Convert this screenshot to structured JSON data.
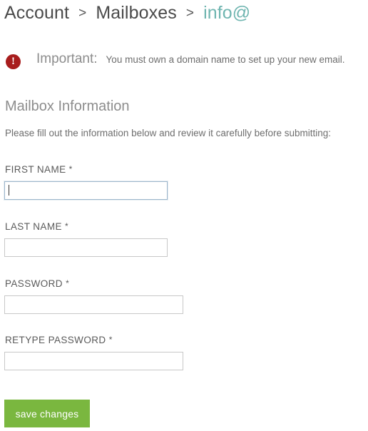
{
  "breadcrumb": {
    "items": [
      {
        "label": "Account",
        "current": false
      },
      {
        "label": "Mailboxes",
        "current": false
      },
      {
        "label": "info@",
        "current": true
      }
    ],
    "separator": ">"
  },
  "notice": {
    "icon": "alert-circle-icon",
    "glyph": "!",
    "label": "Important:",
    "message": "You must own a domain name to set up your new email."
  },
  "section": {
    "title": "Mailbox Information",
    "intro": "Please fill out the information below and review it carefully before submitting:"
  },
  "form": {
    "fields": [
      {
        "name": "first-name",
        "label": "FIRST NAME",
        "required": "*",
        "value": "",
        "placeholder": "",
        "focused": true
      },
      {
        "name": "last-name",
        "label": "LAST NAME",
        "required": "*",
        "value": "",
        "placeholder": "",
        "focused": false
      },
      {
        "name": "password",
        "label": "PASSWORD",
        "required": "*",
        "value": "",
        "placeholder": "",
        "focused": false
      },
      {
        "name": "retype-password",
        "label": "RETYPE PASSWORD",
        "required": "*",
        "value": "",
        "placeholder": "",
        "focused": false
      }
    ],
    "submit_label": "save changes"
  },
  "colors": {
    "accent_teal": "#6fb5b0",
    "alert_red": "#a81d1d",
    "button_green": "#7ab73f",
    "heading_gray": "#8d8d8d",
    "body_gray": "#6e6e6e",
    "focus_border": "#9db6cc"
  }
}
